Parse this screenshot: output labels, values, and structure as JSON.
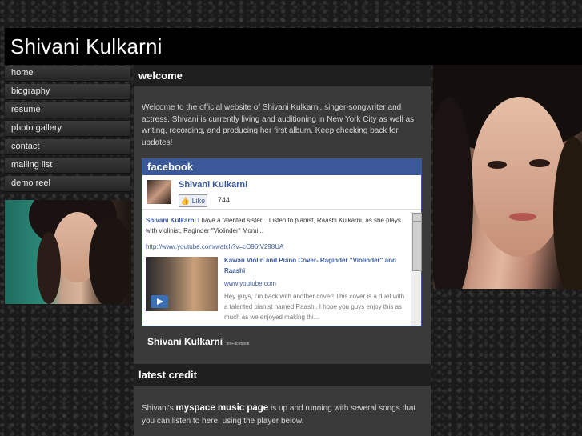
{
  "site": {
    "title": "Shivani Kulkarni"
  },
  "nav": {
    "items": [
      "home",
      "biography",
      "resume",
      "photo gallery",
      "contact",
      "mailing list",
      "demo reel"
    ]
  },
  "welcome": {
    "heading": "welcome",
    "body": "Welcome to the official website of Shivani Kulkarni, singer-songwriter and actress. Shivani is currently living and auditioning in New York City as well as writing, recording, and producing her first album. Keep checking back for updates!"
  },
  "facebook": {
    "brand": "facebook",
    "page_name": "Shivani Kulkarni",
    "like_label": "Like",
    "like_count": "744",
    "post_author": "Shivani Kulkarni",
    "post_text": "I have a talented sister... Listen to pianist, Raashi Kulkarni, as she plays with violinist, Raginder \"Violinder\" Momi...",
    "post_link": "http://www.youtube.com/watch?v=cO96tV298UA",
    "video_title": "Kawan Violin and Piano Cover- Raginder \"Violinder\" and Raashi",
    "video_site": "www.youtube.com",
    "video_desc": "Hey guys, I'm back with another cover! This cover is a duet with a talented pianist named Raashi. I hope you guys enjoy this as much as we enjoyed making thi...",
    "footer_name": "Shivani Kulkarni",
    "footer_suffix": "on Facebook"
  },
  "credit": {
    "heading": "latest credit",
    "prefix": "Shivani's",
    "link": "myspace music page",
    "suffix": "is up and running with several songs that you can listen to here, using the player below."
  }
}
